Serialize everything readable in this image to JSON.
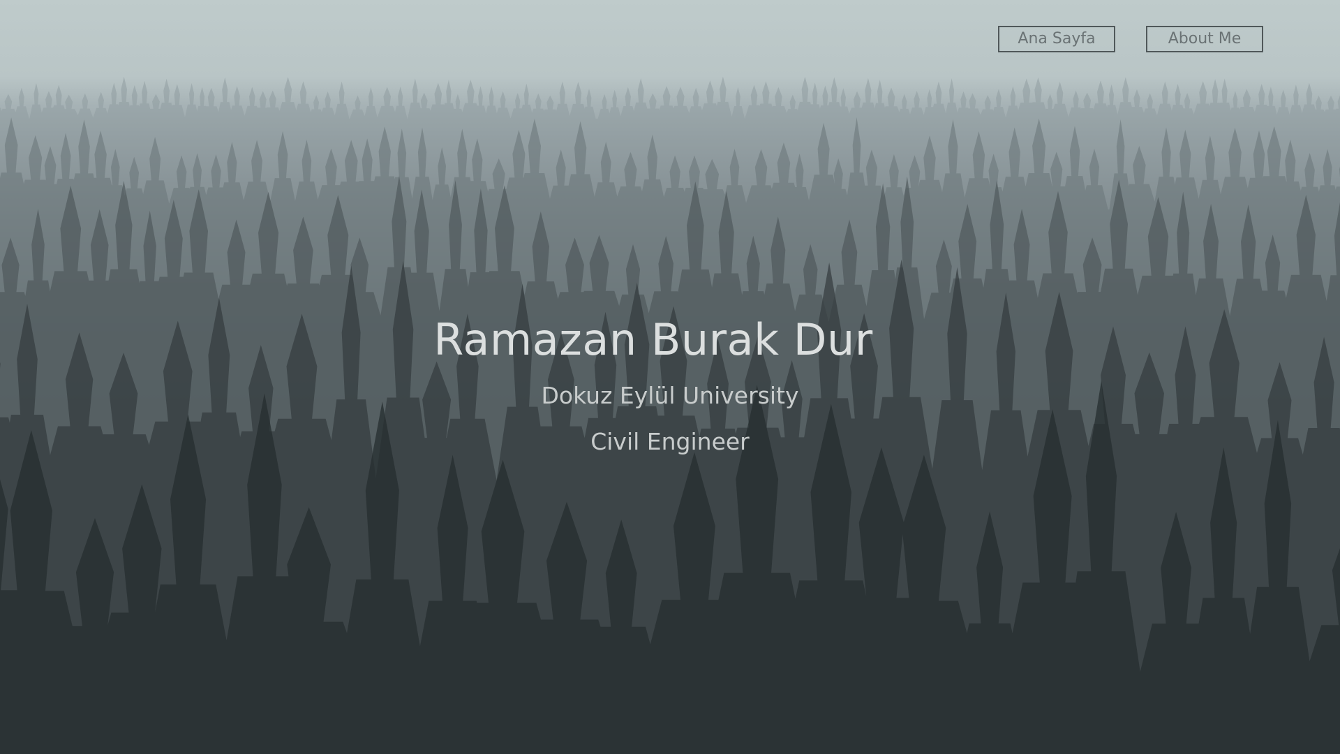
{
  "nav": {
    "home_label": "Ana Sayfa",
    "about_label": "About Me"
  },
  "hero": {
    "name": "Ramazan Burak Dur",
    "university": "Dokuz Eylül University",
    "profession": "Civil Engineer"
  },
  "colors": {
    "sky": "#bfcbcb",
    "forest_dark": "#222a2b",
    "heading_text": "#dcdfdf",
    "nav_border": "#50585a"
  }
}
